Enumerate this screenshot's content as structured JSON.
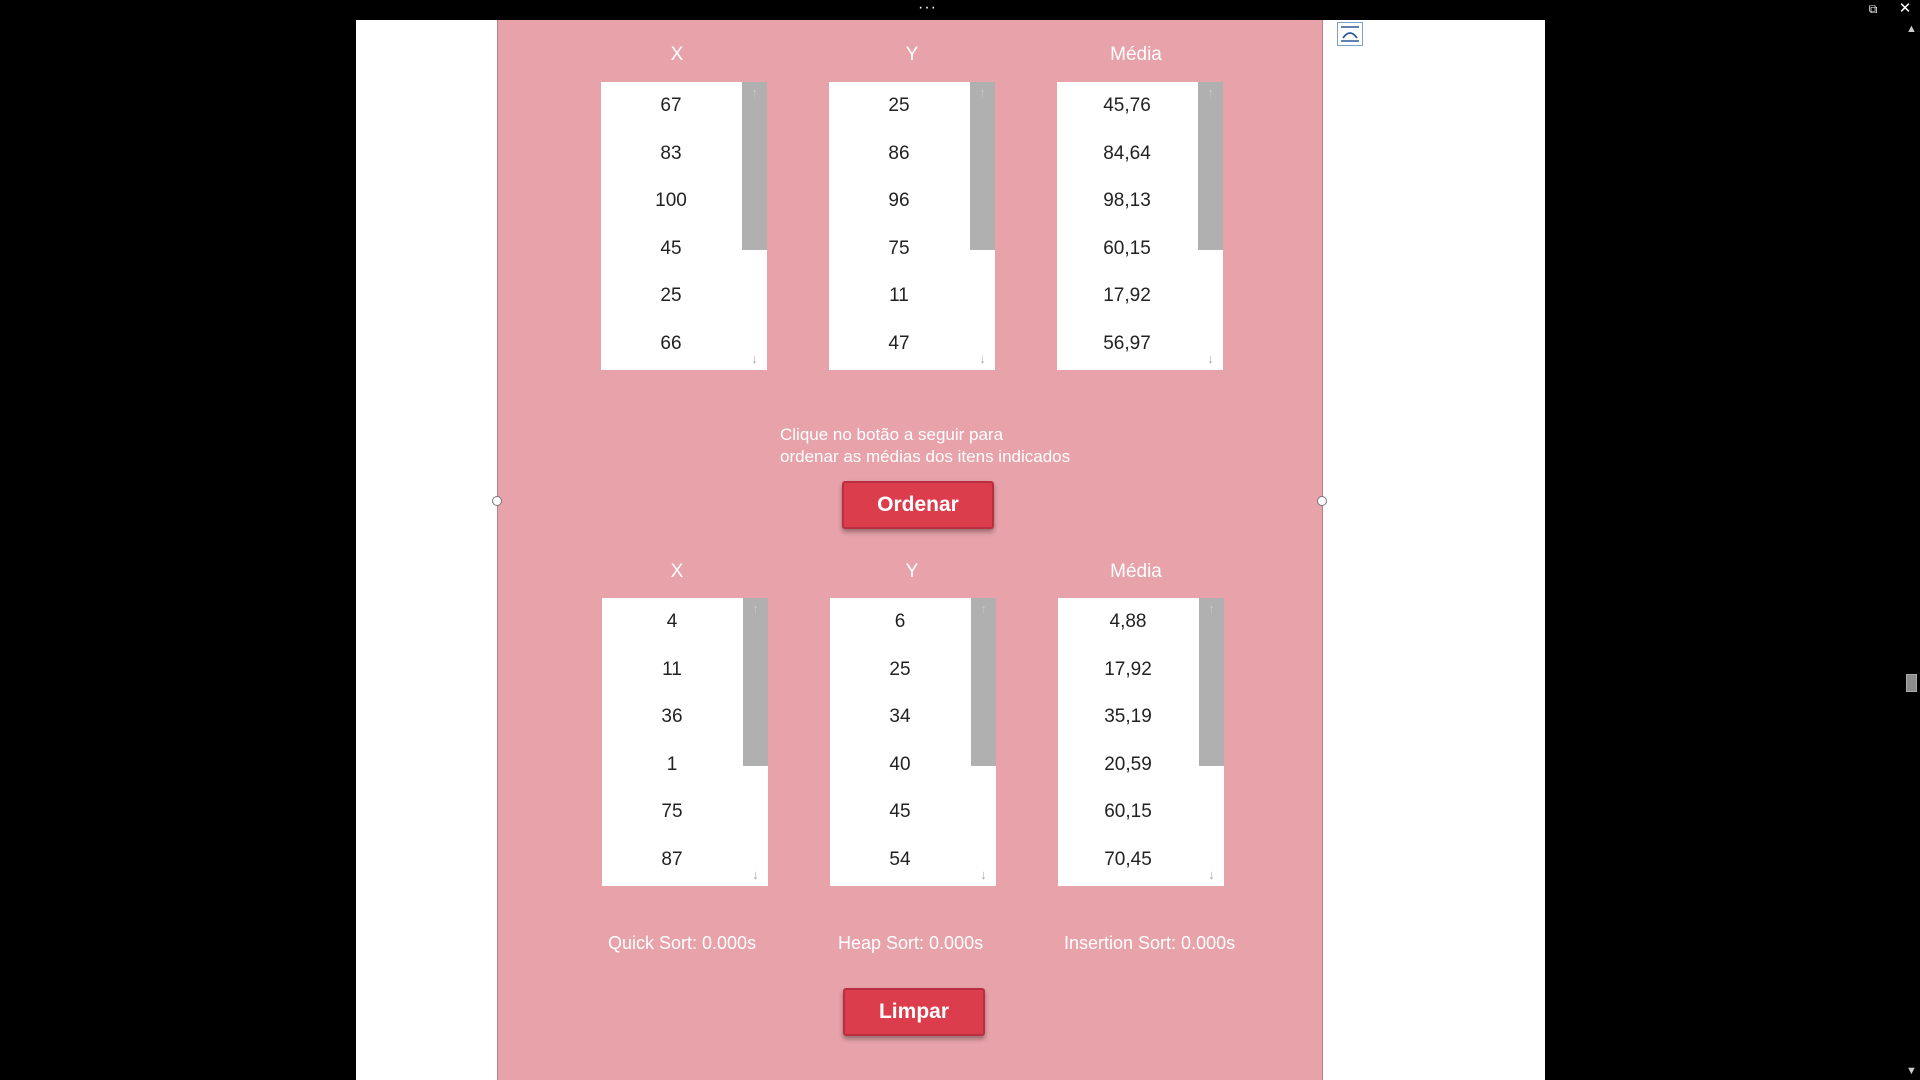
{
  "window": {
    "dots": "···",
    "restore_icon": "restore-icon",
    "close_icon": "close-icon"
  },
  "top_table": {
    "headers": [
      "X",
      "Y",
      "Média"
    ],
    "x": [
      "67",
      "83",
      "100",
      "45",
      "25",
      "66"
    ],
    "y": [
      "25",
      "86",
      "96",
      "75",
      "11",
      "47"
    ],
    "media": [
      "45,76",
      "84,64",
      "98,13",
      "60,15",
      "17,92",
      "56,97"
    ]
  },
  "instruction": {
    "line1": "Clique no botão a seguir para",
    "line2": "ordenar as médias dos itens indicados"
  },
  "buttons": {
    "sort": "Ordenar",
    "clear": "Limpar"
  },
  "bottom_table": {
    "headers": [
      "X",
      "Y",
      "Média"
    ],
    "x": [
      "4",
      "11",
      "36",
      "1",
      "75",
      "87"
    ],
    "y": [
      "6",
      "25",
      "34",
      "40",
      "45",
      "54"
    ],
    "media": [
      "4,88",
      "17,92",
      "35,19",
      "20,59",
      "60,15",
      "70,45"
    ]
  },
  "timings": {
    "quick": "Quick Sort: 0.000s",
    "heap": "Heap Sort: 0.000s",
    "insertion": "Insertion Sort: 0.000s"
  },
  "colors": {
    "panel": "#e8a2aa",
    "button": "#dc3d4d",
    "scroll_thumb": "#b0b0b0"
  }
}
